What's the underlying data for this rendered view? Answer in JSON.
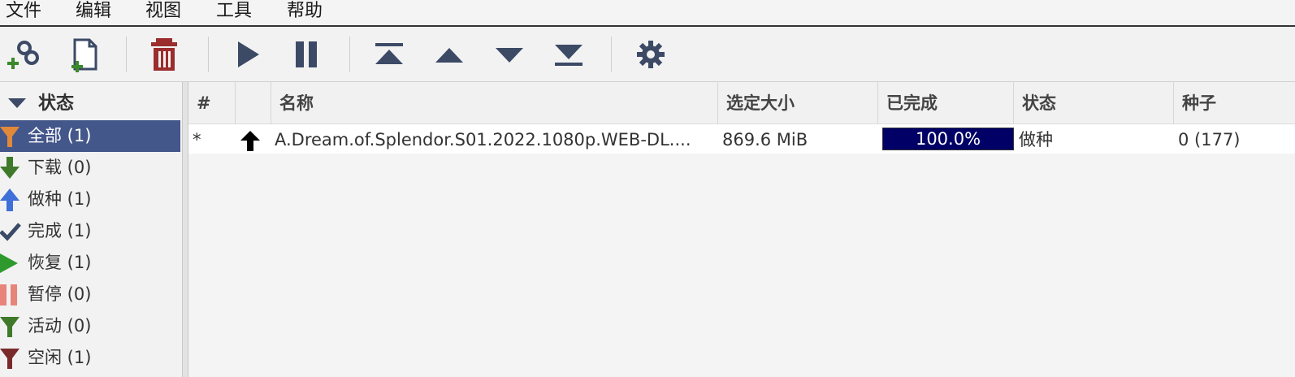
{
  "menu": {
    "file": "文件",
    "edit": "编辑",
    "view": "视图",
    "tools": "工具",
    "help": "帮助"
  },
  "toolbar": {
    "buttons": [
      {
        "name": "add-torrent-url",
        "icon": "link-plus-icon"
      },
      {
        "name": "add-torrent-file",
        "icon": "file-plus-icon"
      },
      {
        "name": "remove-torrent",
        "icon": "trash-icon"
      },
      {
        "name": "resume",
        "icon": "play-icon"
      },
      {
        "name": "pause",
        "icon": "pause-icon"
      },
      {
        "name": "queue-top",
        "icon": "move-top-icon"
      },
      {
        "name": "queue-up",
        "icon": "move-up-icon"
      },
      {
        "name": "queue-down",
        "icon": "move-down-icon"
      },
      {
        "name": "queue-bottom",
        "icon": "move-bottom-icon"
      },
      {
        "name": "preferences",
        "icon": "gear-icon"
      }
    ]
  },
  "sidebar": {
    "header": "状态",
    "items": [
      {
        "label": "全部 (1)",
        "icon": "funnel-icon",
        "color": "#e0893a",
        "selected": true
      },
      {
        "label": "下载 (0)",
        "icon": "arrow-down-icon",
        "color": "#3f7a2a"
      },
      {
        "label": "做种 (1)",
        "icon": "arrow-up-icon",
        "color": "#3f6fd8"
      },
      {
        "label": "完成 (1)",
        "icon": "check-icon",
        "color": "#3a4a66"
      },
      {
        "label": "恢复 (1)",
        "icon": "play-icon",
        "color": "#2e9a2e"
      },
      {
        "label": "暂停 (0)",
        "icon": "pause-icon",
        "color": "#e8857a"
      },
      {
        "label": "活动 (0)",
        "icon": "funnel-icon",
        "color": "#3f7a2a"
      },
      {
        "label": "空闲 (1)",
        "icon": "funnel-icon",
        "color": "#7a2a2a"
      }
    ]
  },
  "table": {
    "columns": [
      "#",
      "",
      "名称",
      "选定大小",
      "已完成",
      "状态",
      "种子"
    ],
    "rows": [
      {
        "index": "*",
        "state_icon": "arrow-up-icon",
        "name": "A.Dream.of.Splendor.S01.2022.1080p.WEB-DL....",
        "size": "869.6 MiB",
        "progress": 100.0,
        "progress_label": "100.0%",
        "status": "做种",
        "seeds": "0 (177)"
      }
    ]
  },
  "colors": {
    "selection": "#44578b",
    "progress_fill": "#000066",
    "icon_dark": "#3c4a66",
    "trash": "#9b2d2d"
  }
}
